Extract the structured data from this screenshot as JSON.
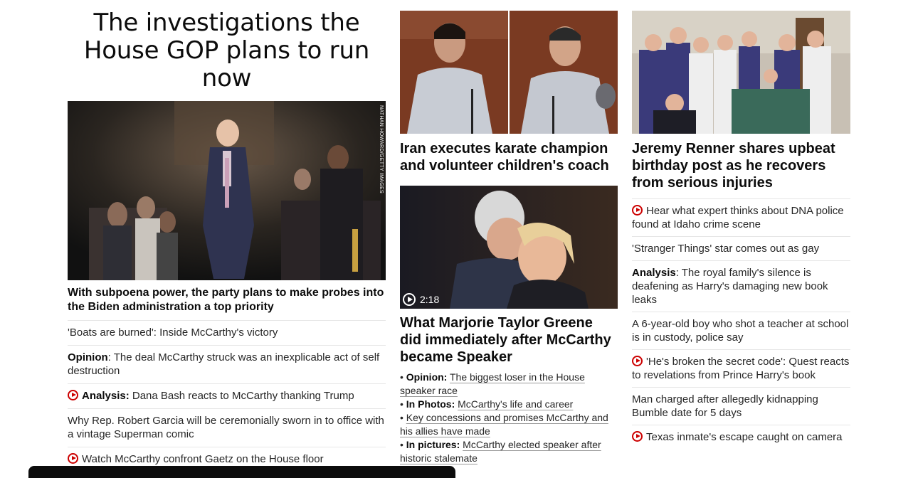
{
  "left": {
    "headline": "The investigations the House GOP plans to run now",
    "photo_credit": "NATHAN HOWARD/GETTY IMAGES",
    "lead_text": "With subpoena power, the party plans to make probes into the Biden administration a top priority",
    "links": [
      {
        "video": false,
        "prefix": "",
        "text": "'Boats are burned': Inside McCarthy's victory"
      },
      {
        "video": false,
        "prefix": "Opinion",
        "text": ": The deal McCarthy struck was an inexplicable act of self destruction"
      },
      {
        "video": true,
        "prefix": "Analysis:",
        "text": " Dana Bash reacts to McCarthy thanking Trump"
      },
      {
        "video": false,
        "prefix": "",
        "text": "Why Rep. Robert Garcia will be ceremonially sworn in to office with a vintage Superman comic"
      },
      {
        "video": true,
        "prefix": "",
        "text": "Watch McCarthy confront Gaetz on the House floor"
      }
    ]
  },
  "middle": {
    "story1_headline": "Iran executes karate champion and volunteer children's coach",
    "story2_duration": "2:18",
    "story2_headline": "What Marjorie Taylor Greene did immediately after McCarthy became Speaker",
    "bullets": [
      {
        "prefix": "Opinion:",
        "text": "The biggest loser in the House speaker race"
      },
      {
        "prefix": "In Photos:",
        "text": "McCarthy's life and career"
      },
      {
        "prefix": "",
        "text": "Key concessions and promises McCarthy and his allies have made"
      },
      {
        "prefix": "In pictures:",
        "text": "McCarthy elected speaker after historic stalemate"
      }
    ]
  },
  "right": {
    "headline": "Jeremy Renner shares upbeat birthday post as he recovers from serious injuries",
    "links": [
      {
        "video": true,
        "prefix": "",
        "text": "Hear what expert thinks about DNA police found at Idaho crime scene"
      },
      {
        "video": false,
        "prefix": "",
        "text": "'Stranger Things' star comes out as gay"
      },
      {
        "video": false,
        "prefix": "Analysis",
        "text": ": The royal family's silence is deafening as Harry's damaging new book leaks"
      },
      {
        "video": false,
        "prefix": "",
        "text": "A 6-year-old boy who shot a teacher at school is in custody, police say"
      },
      {
        "video": true,
        "prefix": "",
        "text": "'He's broken the secret code': Quest reacts to revelations from Prince Harry's book"
      },
      {
        "video": false,
        "prefix": "",
        "text": "Man charged after allegedly kidnapping Bumble date for 5 days"
      },
      {
        "video": true,
        "prefix": "",
        "text": "Texas inmate's escape caught on camera"
      }
    ]
  }
}
